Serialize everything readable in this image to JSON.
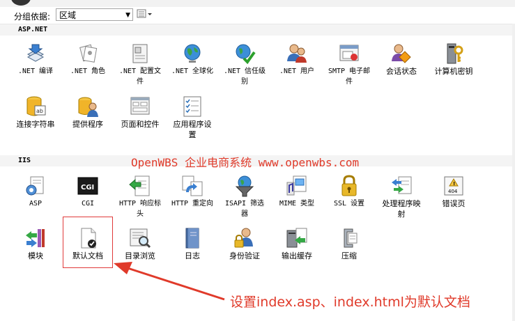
{
  "toolbar": {
    "group_by_label": "分组依据:",
    "group_by_value": "区域",
    "view_icon": "view-list-icon"
  },
  "sections": {
    "aspnet": {
      "title": "ASP.NET",
      "items": [
        {
          "label_line1": ".NET 编译",
          "label_line2": "",
          "icon": "compile-icon"
        },
        {
          "label_line1": ".NET 角色",
          "label_line2": "",
          "icon": "roles-icon"
        },
        {
          "label_line1": ".NET 配置文",
          "label_line2": "件",
          "icon": "profile-icon"
        },
        {
          "label_line1": ".NET 全球化",
          "label_line2": "",
          "icon": "globe-icon"
        },
        {
          "label_line1": ".NET 信任级",
          "label_line2": "别",
          "icon": "trust-icon"
        },
        {
          "label_line1": ".NET 用户",
          "label_line2": "",
          "icon": "users-icon"
        },
        {
          "label_line1": "SMTP 电子邮",
          "label_line2": "件",
          "icon": "smtp-icon"
        },
        {
          "label_line1": "会话状态",
          "label_line2": "",
          "icon": "session-icon"
        },
        {
          "label_line1": "计算机密钥",
          "label_line2": "",
          "icon": "machine-key-icon"
        },
        {
          "label_line1": "连接字符串",
          "label_line2": "",
          "icon": "connection-string-icon"
        },
        {
          "label_line1": "提供程序",
          "label_line2": "",
          "icon": "providers-icon"
        },
        {
          "label_line1": "页面和控件",
          "label_line2": "",
          "icon": "pages-controls-icon"
        },
        {
          "label_line1": "应用程序设",
          "label_line2": "置",
          "icon": "app-settings-icon"
        }
      ]
    },
    "iis": {
      "title": "IIS",
      "items": [
        {
          "label_line1": "ASP",
          "label_line2": "",
          "icon": "asp-icon"
        },
        {
          "label_line1": "CGI",
          "label_line2": "",
          "icon": "cgi-icon"
        },
        {
          "label_line1": "HTTP 响应标",
          "label_line2": "头",
          "icon": "http-headers-icon"
        },
        {
          "label_line1": "HTTP 重定向",
          "label_line2": "",
          "icon": "http-redirect-icon"
        },
        {
          "label_line1": "ISAPI 筛选",
          "label_line2": "器",
          "icon": "isapi-filters-icon"
        },
        {
          "label_line1": "MIME 类型",
          "label_line2": "",
          "icon": "mime-types-icon"
        },
        {
          "label_line1": "SSL 设置",
          "label_line2": "",
          "icon": "ssl-lock-icon"
        },
        {
          "label_line1": "处理程序映",
          "label_line2": "射",
          "icon": "handler-mappings-icon"
        },
        {
          "label_line1": "错误页",
          "label_line2": "",
          "icon": "error-pages-icon"
        },
        {
          "label_line1": "模块",
          "label_line2": "",
          "icon": "modules-icon"
        },
        {
          "label_line1": "默认文档",
          "label_line2": "",
          "icon": "default-document-icon"
        },
        {
          "label_line1": "目录浏览",
          "label_line2": "",
          "icon": "directory-browsing-icon"
        },
        {
          "label_line1": "日志",
          "label_line2": "",
          "icon": "logging-icon"
        },
        {
          "label_line1": "身份验证",
          "label_line2": "",
          "icon": "authentication-icon"
        },
        {
          "label_line1": "输出缓存",
          "label_line2": "",
          "icon": "output-caching-icon"
        },
        {
          "label_line1": "压缩",
          "label_line2": "",
          "icon": "compression-icon"
        }
      ]
    }
  },
  "watermark": "OpenWBS 企业电商系统 www.openwbs.com",
  "annotation": "设置index.asp、index.html为默认文档",
  "colors": {
    "annotation_red": "#e03a2a",
    "section_bg": "#f4f4f4",
    "selection_border": "#e03a3a"
  }
}
